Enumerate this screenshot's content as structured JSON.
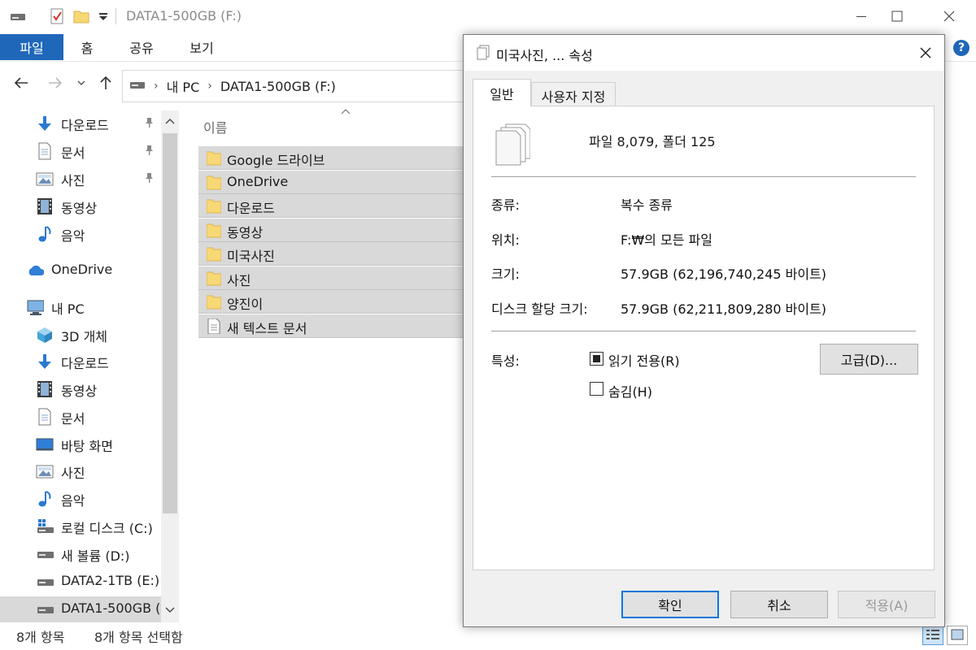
{
  "explorer": {
    "window_title": "DATA1-500GB (F:)",
    "quick_access_icons": [
      "drive-icon",
      "properties-check-icon",
      "new-folder-icon",
      "customize-dropdown-icon"
    ],
    "ribbon_tabs": [
      "파일",
      "홈",
      "공유",
      "보기"
    ],
    "address": {
      "crumbs": [
        "내 PC",
        "DATA1-500GB (F:)"
      ]
    },
    "nav_items": [
      {
        "label": "다운로드",
        "icon": "download-arrow-icon",
        "pinned": true
      },
      {
        "label": "문서",
        "icon": "document-icon",
        "pinned": true
      },
      {
        "label": "사진",
        "icon": "pictures-icon",
        "pinned": true
      },
      {
        "label": "동영상",
        "icon": "video-icon",
        "pinned": false
      },
      {
        "label": "음악",
        "icon": "music-note-icon",
        "pinned": false
      },
      {
        "label": "OneDrive",
        "icon": "cloud-icon",
        "pinned": false
      },
      {
        "label": "내 PC",
        "icon": "computer-icon",
        "pinned": false
      },
      {
        "label": "3D 개체",
        "icon": "cube-3d-icon",
        "pinned": false
      },
      {
        "label": "다운로드",
        "icon": "download-arrow-icon",
        "pinned": false
      },
      {
        "label": "동영상",
        "icon": "video-icon",
        "pinned": false
      },
      {
        "label": "문서",
        "icon": "document-icon",
        "pinned": false
      },
      {
        "label": "바탕 화면",
        "icon": "desktop-icon",
        "pinned": false
      },
      {
        "label": "사진",
        "icon": "pictures-icon",
        "pinned": false
      },
      {
        "label": "음악",
        "icon": "music-note-icon",
        "pinned": false
      },
      {
        "label": "로컬 디스크 (C:)",
        "icon": "system-drive-icon",
        "pinned": false
      },
      {
        "label": "새 볼륨 (D:)",
        "icon": "drive-icon",
        "pinned": false
      },
      {
        "label": "DATA2-1TB (E:)",
        "icon": "drive-icon",
        "pinned": false
      },
      {
        "label": "DATA1-500GB (",
        "icon": "drive-icon",
        "pinned": false,
        "selected": true
      }
    ],
    "column_header": "이름",
    "files": [
      {
        "name": "Google 드라이브",
        "type": "folder"
      },
      {
        "name": "OneDrive",
        "type": "folder"
      },
      {
        "name": "다운로드",
        "type": "folder"
      },
      {
        "name": "동영상",
        "type": "folder"
      },
      {
        "name": "미국사진",
        "type": "folder"
      },
      {
        "name": "사진",
        "type": "folder"
      },
      {
        "name": "양진이",
        "type": "folder"
      },
      {
        "name": "새 텍스트 문서",
        "type": "text-file"
      }
    ],
    "status": {
      "item_count": "8개 항목",
      "selected_count": "8개 항목 선택함"
    }
  },
  "dialog": {
    "title": "미국사진, ... 속성",
    "tabs": [
      "일반",
      "사용자 지정"
    ],
    "active_tab": "일반",
    "summary": "파일 8,079, 폴더 125",
    "properties": [
      {
        "label": "종류:",
        "value": "복수 종류"
      },
      {
        "label": "위치:",
        "value": "F:₩의 모든 파일"
      },
      {
        "label": "크기:",
        "value": "57.9GB (62,196,740,245 바이트)"
      },
      {
        "label": "디스크 할당 크기:",
        "value": "57.9GB (62,211,809,280 바이트)"
      }
    ],
    "attributes_label": "특성:",
    "readonly_label": "읽기 전용(R)",
    "readonly_state": "indeterminate",
    "hidden_label": "숨김(H)",
    "hidden_state": "unchecked",
    "advanced_button": "고급(D)...",
    "ok_button": "확인",
    "cancel_button": "취소",
    "apply_button": "적용(A)"
  },
  "colors": {
    "accent": "#1f67b9",
    "selection": "#d9d9d9",
    "folder": "#f8d775",
    "focus_border": "#0078d7"
  }
}
